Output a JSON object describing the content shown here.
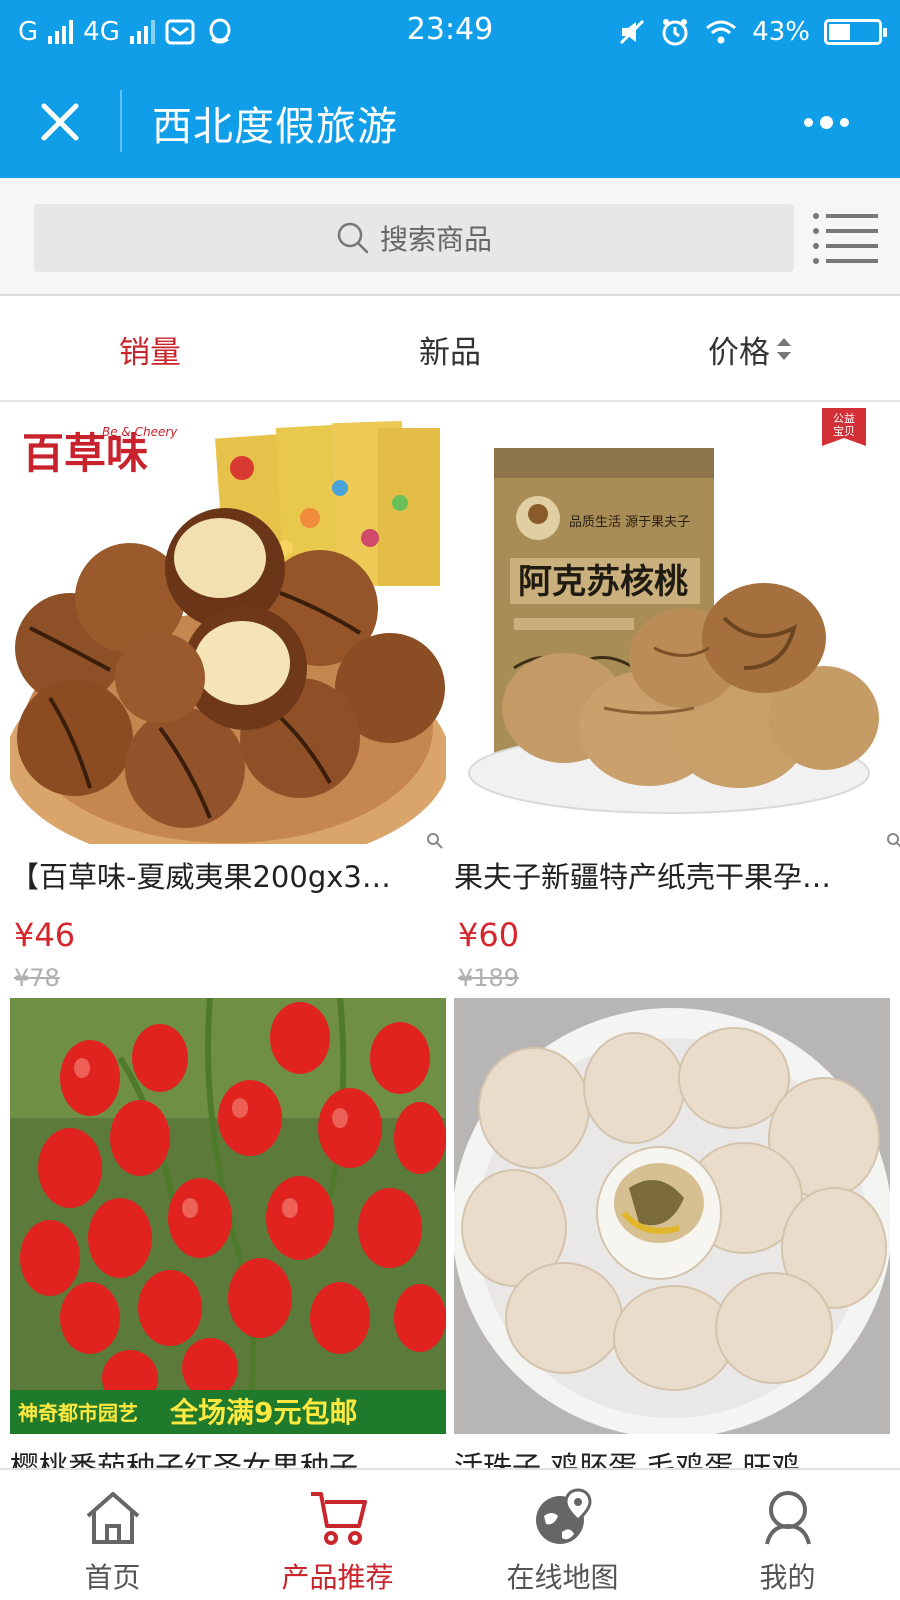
{
  "status_bar": {
    "carrier": "G",
    "network": "4G",
    "time": "23:49",
    "battery": "43%",
    "battery_level": 0.43
  },
  "nav": {
    "title": "西北度假旅游"
  },
  "search": {
    "placeholder": "搜索商品"
  },
  "sort_tabs": [
    {
      "label": "销量",
      "active": true
    },
    {
      "label": "新品",
      "active": false
    },
    {
      "label": "价格",
      "active": false
    }
  ],
  "products": [
    {
      "title": "【百草味-夏威夷果200gx3…",
      "price": "¥46",
      "original_price": "¥78",
      "image_brand": "百草味",
      "image_brand_en": "Be & Cheery"
    },
    {
      "title": "果夫子新疆特产纸壳干果孕…",
      "price": "¥60",
      "original_price": "¥189",
      "image_badge": "公益宝贝",
      "image_package_text": "阿克苏核桃",
      "image_package_slogan": "品质生活 源于果夫子"
    },
    {
      "title": "樱桃番茄种子红圣女果种子…",
      "image_banner_left": "神奇都市园艺",
      "image_banner_right": "全场满9元包邮"
    },
    {
      "title": "活珠子 鸡胚蛋 毛鸡蛋 旺鸡…"
    }
  ],
  "tab_bar": [
    {
      "label": "首页",
      "icon": "home-icon",
      "active": false
    },
    {
      "label": "产品推荐",
      "icon": "cart-icon",
      "active": true
    },
    {
      "label": "在线地图",
      "icon": "globe-pin-icon",
      "active": false
    },
    {
      "label": "我的",
      "icon": "user-icon",
      "active": false
    }
  ],
  "colors": {
    "header_blue": "#109ee9",
    "accent_red": "#c8252c",
    "price_red": "#d6262d"
  }
}
